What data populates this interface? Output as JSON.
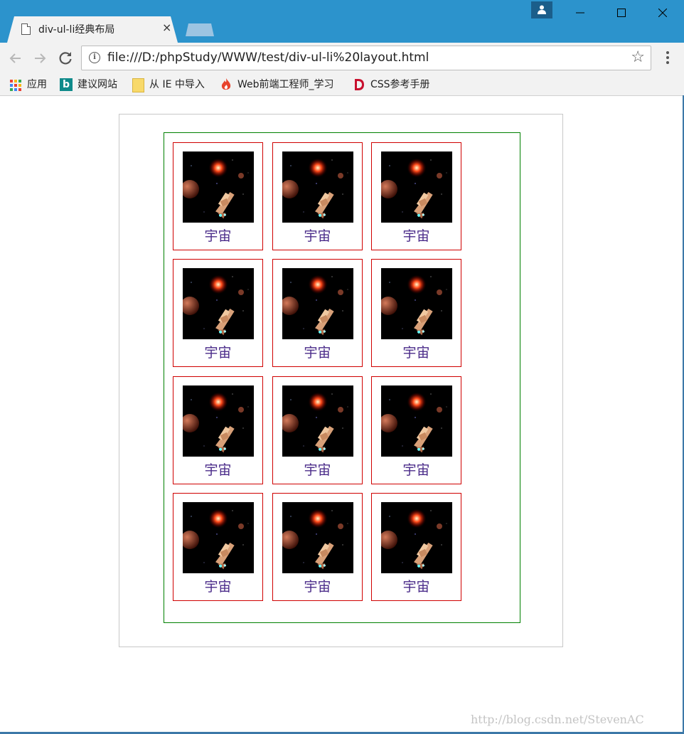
{
  "browser": {
    "tab_title": "div-ul-li经典布局",
    "tab_close": "×",
    "url": "file:///D:/phpStudy/WWW/test/div-ul-li%20layout.html",
    "star": "☆",
    "bookmarks": [
      {
        "label": "应用",
        "icon": "apps-grid-icon"
      },
      {
        "label": "建议网站",
        "icon": "bing-icon"
      },
      {
        "label": "从 IE 中导入",
        "icon": "folder-icon"
      },
      {
        "label": "Web前端工程师_学习",
        "icon": "flame-icon"
      },
      {
        "label": "CSS参考手册",
        "icon": "d-logo-icon"
      }
    ],
    "bing_letter": "b",
    "info_glyph": "i"
  },
  "page": {
    "caption": "宇宙",
    "grid_items": [
      {
        "caption": "宇宙"
      },
      {
        "caption": "宇宙"
      },
      {
        "caption": "宇宙"
      },
      {
        "caption": "宇宙"
      },
      {
        "caption": "宇宙"
      },
      {
        "caption": "宇宙"
      },
      {
        "caption": "宇宙"
      },
      {
        "caption": "宇宙"
      },
      {
        "caption": "宇宙"
      },
      {
        "caption": "宇宙"
      },
      {
        "caption": "宇宙"
      },
      {
        "caption": "宇宙"
      }
    ]
  },
  "watermark": "http://blog.csdn.net/StevenAC",
  "colors": {
    "titlebar": "#2c93cc",
    "cell_border": "#d00000",
    "container_border": "#008000",
    "caption": "#4b2c8a"
  }
}
